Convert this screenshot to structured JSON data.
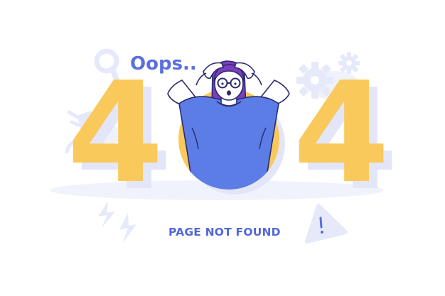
{
  "headline": "Oops..",
  "error_code": {
    "left_digit": "4",
    "right_digit": "4"
  },
  "message": "PAGE NOT FOUND",
  "colors": {
    "headline": "#5a6fe0",
    "digits": "#fac95c",
    "digit_shadow": "#e3e6f8",
    "shirt": "#5c7de6",
    "hair": "#7b3fbd",
    "outline": "#2a2a6e",
    "decorations": "#e6e9f9",
    "background": "#ffffff"
  },
  "decorations": [
    "magnifier-icon",
    "plug-icon",
    "gear-large-icon",
    "gear-small-icon",
    "lightning-icon",
    "warning-icon"
  ]
}
